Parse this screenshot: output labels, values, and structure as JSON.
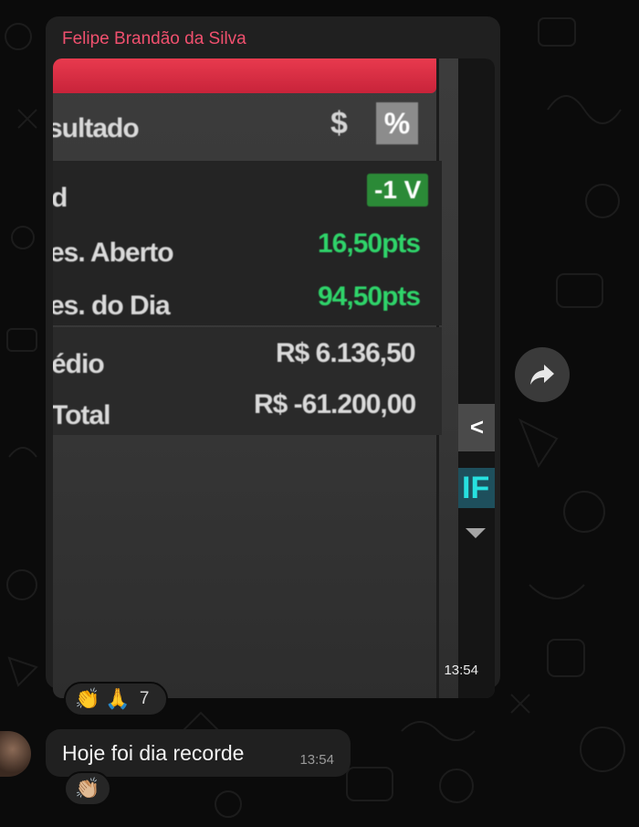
{
  "message1": {
    "sender": "Felipe Brandão da Silva",
    "time": "13:54",
    "photo": {
      "resultado_label": "sultado",
      "dollar_symbol": "$",
      "percent_symbol": "%",
      "qtd_label": "d",
      "qtd_value": "-1 V",
      "aberto_label": "es. Aberto",
      "aberto_value": "16,50pts",
      "dia_label": "es. do Dia",
      "dia_value": "94,50pts",
      "medio_label": "édio",
      "medio_value": "R$ 6.136,50",
      "total_label": "Total",
      "total_value": "R$ -61.200,00",
      "side_chevron": "<",
      "side_letters": "IF"
    },
    "reactions": {
      "emojis": [
        "👏",
        "🙏"
      ],
      "count": "7"
    }
  },
  "message2": {
    "text": "Hoje foi dia recorde",
    "time": "13:54",
    "reactions": {
      "emojis": [
        "👏🏼"
      ]
    }
  },
  "icons": {
    "forward": "forward-arrow-icon"
  },
  "colors": {
    "sender": "#f0506e",
    "bubble": "#202020",
    "green": "#2fd46a",
    "background": "#0b0b0b"
  }
}
